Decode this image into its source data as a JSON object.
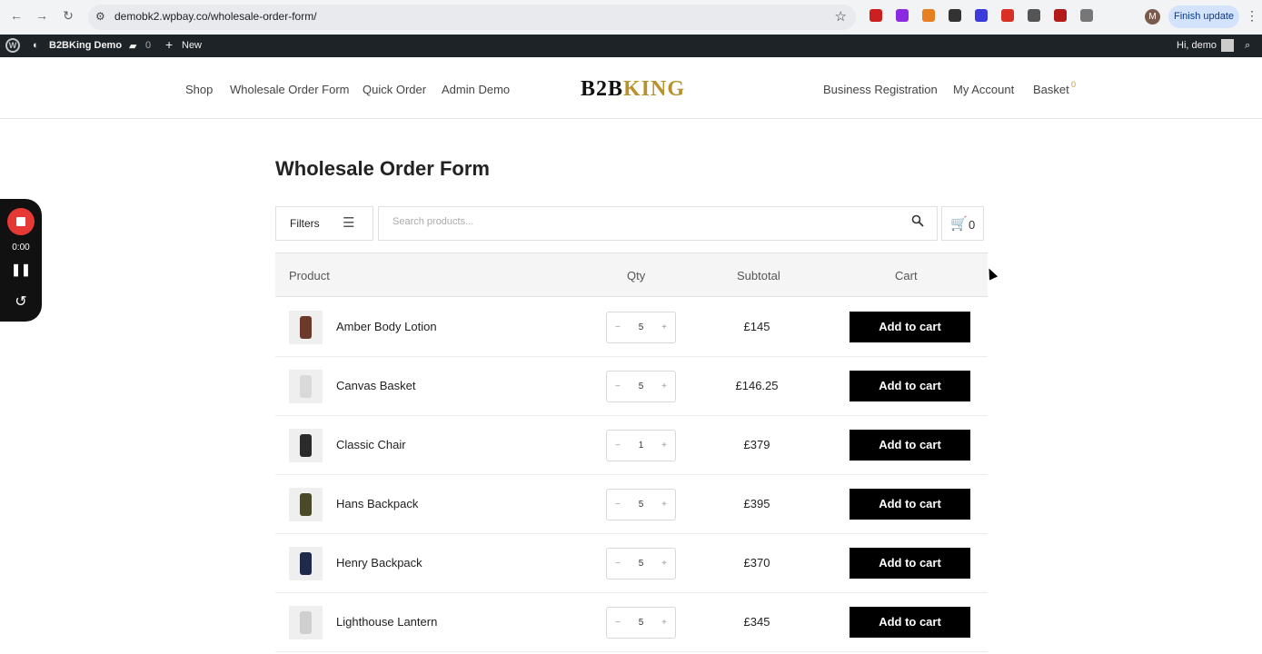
{
  "browser": {
    "url": "demobk2.wpbay.co/wholesale-order-form/",
    "finish_update": "Finish update",
    "profile_initial": "M",
    "extension_colors": [
      "#cc1f1f",
      "#8a2be2",
      "#e67e22",
      "#333333",
      "#3b3bdb",
      "#d93025",
      "#555555",
      "#b31b1b",
      "#777777"
    ]
  },
  "adminbar": {
    "site_name": "B2BKing Demo",
    "comments_count": "0",
    "new_label": "New",
    "greeting": "Hi, demo"
  },
  "header": {
    "nav_left": [
      "Shop",
      "Wholesale Order Form",
      "Quick Order",
      "Admin Demo"
    ],
    "logo": {
      "part1": "B2B",
      "part2": "KING"
    },
    "nav_right": [
      "Business Registration",
      "My Account",
      "Basket"
    ],
    "basket_count": "0"
  },
  "recorder": {
    "time": "0:00"
  },
  "page": {
    "title": "Wholesale Order Form",
    "filters_label": "Filters",
    "search_placeholder": "Search products...",
    "cart_count": "0"
  },
  "table": {
    "headers": {
      "product": "Product",
      "qty": "Qty",
      "subtotal": "Subtotal",
      "cart": "Cart"
    },
    "add_to_cart_label": "Add to cart",
    "rows": [
      {
        "name": "Amber Body Lotion",
        "qty": "5",
        "subtotal": "£145"
      },
      {
        "name": "Canvas Basket",
        "qty": "5",
        "subtotal": "£146.25"
      },
      {
        "name": "Classic Chair",
        "qty": "1",
        "subtotal": "£379"
      },
      {
        "name": "Hans Backpack",
        "qty": "5",
        "subtotal": "£395"
      },
      {
        "name": "Henry Backpack",
        "qty": "5",
        "subtotal": "£370"
      },
      {
        "name": "Lighthouse Lantern",
        "qty": "5",
        "subtotal": "£345"
      }
    ]
  }
}
